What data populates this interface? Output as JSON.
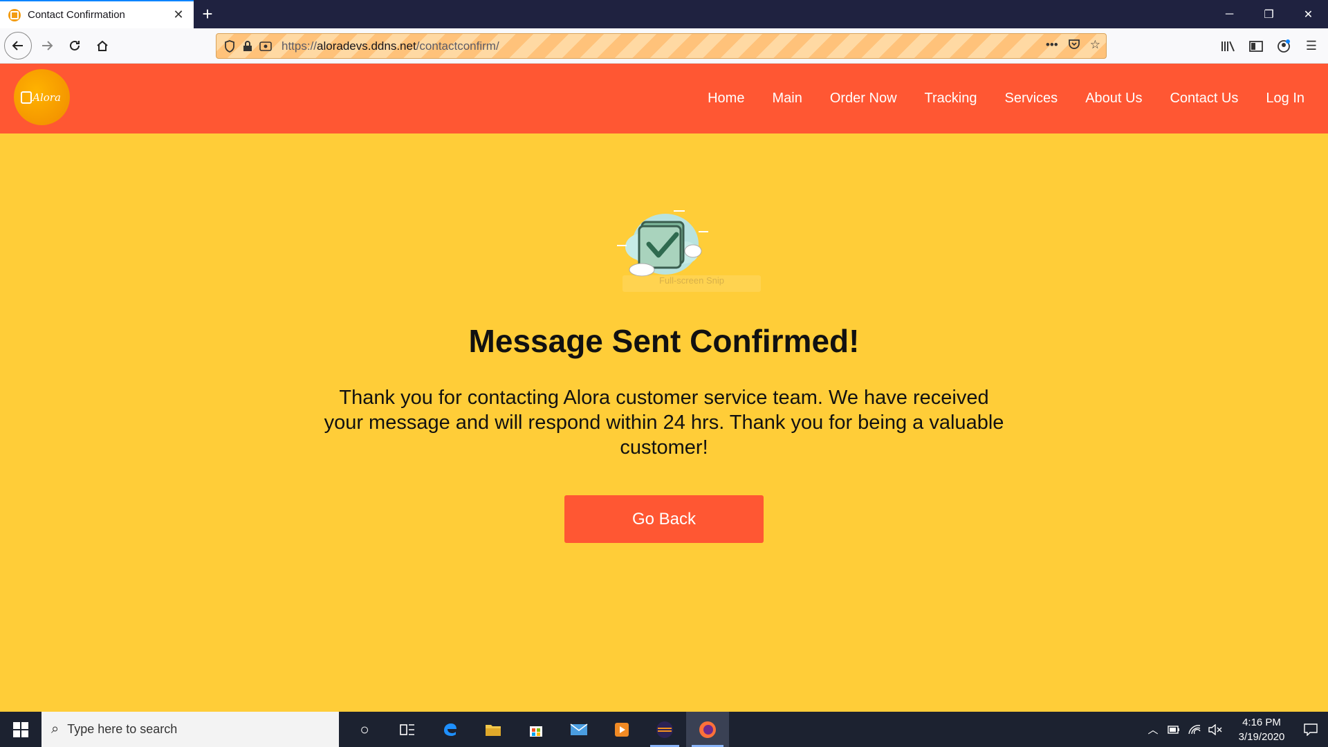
{
  "browser": {
    "tab_title": "Contact Confirmation",
    "url_scheme": "https://",
    "url_host": "aloradevs.ddns.net",
    "url_path": "/contactconfirm/"
  },
  "site": {
    "logo_text": "Alora",
    "nav": [
      "Home",
      "Main",
      "Order Now",
      "Tracking",
      "Services",
      "About Us",
      "Contact Us",
      "Log In"
    ]
  },
  "content": {
    "snip_label": "Full-screen Snip",
    "heading": "Message Sent Confirmed!",
    "message": "Thank you for contacting Alora customer service team. We have received your message and will respond within 24 hrs. Thank you for being a valuable customer!",
    "button": "Go Back"
  },
  "taskbar": {
    "search_placeholder": "Type here to search",
    "time": "4:16 PM",
    "date": "3/19/2020"
  },
  "colors": {
    "page_bg": "#ffcd38",
    "header_bg": "#ff5733",
    "button_bg": "#ff5733"
  }
}
